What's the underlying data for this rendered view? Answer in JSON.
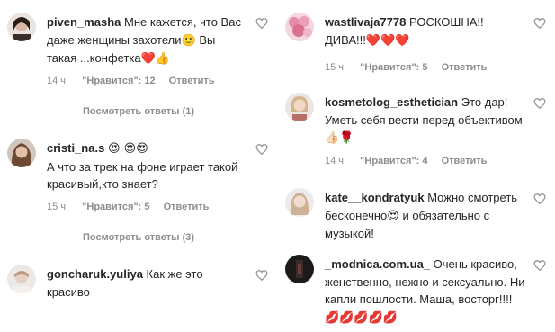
{
  "left": [
    {
      "username": "piven_masha",
      "text_parts": [
        "Мне кажется, что Вас даже женщины захотели",
        "Вы такая ...конфетка"
      ],
      "emojis_a": "🙂",
      "emojis_b": "❤️👍",
      "time": "14 ч.",
      "likes": "\"Нравится\": 12",
      "reply": "Ответить",
      "view_replies": "Посмотреть ответы (1)"
    },
    {
      "username": "cristi_na.s",
      "emojis_a": "😍 😍😍",
      "text": "А что за трек на фоне играет такой красивый,кто знает?",
      "time": "15 ч.",
      "likes": "\"Нравится\": 5",
      "reply": "Ответить",
      "view_replies": "Посмотреть ответы (3)"
    },
    {
      "username": "goncharuk.yuliya",
      "text": "Как же это красиво"
    }
  ],
  "right": [
    {
      "username": "wastlivaja7778",
      "text": "РОСКОШНА!! ДИВА!!!",
      "emojis_a": "❤️❤️❤️",
      "time": "15 ч.",
      "likes": "\"Нравится\": 5",
      "reply": "Ответить"
    },
    {
      "username": "kosmetolog_esthetician",
      "text": "Это дар! Уметь себя вести перед объективом",
      "emojis_a": "👍🏻🌹",
      "time": "14 ч.",
      "likes": "\"Нравится\": 4",
      "reply": "Ответить"
    },
    {
      "username": "kate__kondratyuk",
      "text_a": "Можно смотреть бесконечно",
      "emojis_a": "😍",
      "text_b": "и обязательно с музыкой!"
    },
    {
      "username": "_modnica.com.ua_",
      "text": "Очень красиво, женственно, нежно и сексуально. Ни капли пошлости. Маша, восторг!!!!",
      "emojis_a": "💋💋💋💋💋"
    }
  ],
  "colors": {
    "text": "#262626",
    "meta": "#8e8e8e",
    "heart_stroke": "#8e8e8e"
  }
}
